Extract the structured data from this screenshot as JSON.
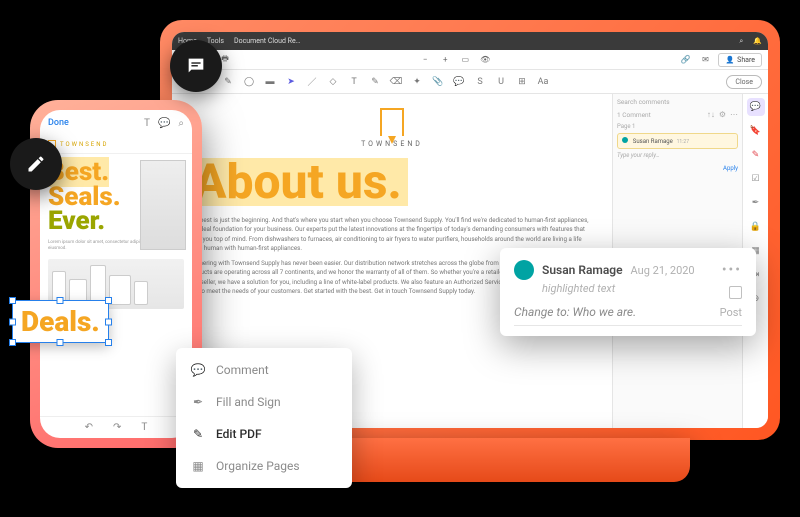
{
  "desktop": {
    "menubar": {
      "home": "Home",
      "tools": "Tools",
      "doc_tab": "Document Cloud Re…"
    },
    "toolbar": {
      "share": "Share",
      "close": "Close"
    },
    "document": {
      "brand": "TOWNSEND",
      "heading": "About us.",
      "para1": "The best is just the beginning. And that's where you start when you choose Townsend Supply. You'll find we're dedicated to human-first appliances, the ideal foundation for your business. Our experts put the latest innovations at the fingertips of today's demanding consumers with features that keep you top of mind. From dishwashers to furnaces, air conditioning to air fryers to water purifiers, households around the world are living a life more human with human-first appliances.",
      "para2": "Partnering with Townsend Supply has never been easier. Our distribution network stretches across the globe from Nantucket to Timbuktu. Our products are operating across all 7 continents, and we honor the warranty of all of them. So whether you're a retailer, contractor, plumber, wholesaler or reseller, we have a solution for you, including a line of white-label products. We also feature an Authorized Service Provider program that will allow you to meet the needs of your customers. Get started with the best. Get in touch Townsend Supply today."
    },
    "comments": {
      "search_placeholder": "Search comments",
      "count_label": "1 Comment",
      "page_label": "Page 1",
      "item": {
        "author": "Susan Ramage",
        "time": "11:27"
      },
      "reply_placeholder": "Type your reply…",
      "apply": "Apply"
    }
  },
  "mobile": {
    "done": "Done",
    "brand": "TOWNSEND",
    "heading_lines": [
      "Best.",
      "Seals.",
      "Ever."
    ],
    "footer": {
      "undo": "↶",
      "redo": "↷",
      "text": "T"
    }
  },
  "deals_selection": "Deals.",
  "context_menu": {
    "comment": "Comment",
    "fill_sign": "Fill and Sign",
    "edit_pdf": "Edit PDF",
    "organize": "Organize Pages"
  },
  "comment_card": {
    "author": "Susan Ramage",
    "date": "Aug 21, 2020",
    "subtitle": "highlighted text",
    "suggestion": "Change to: Who we are.",
    "post": "Post"
  }
}
